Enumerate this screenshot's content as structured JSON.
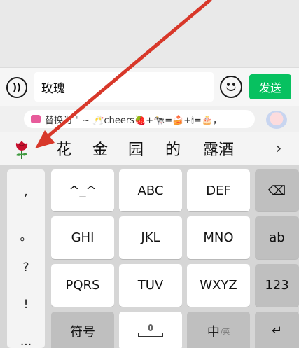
{
  "input_bar": {
    "message_text": "玫瑰",
    "send_label": "发送",
    "voice_icon": "voice-icon",
    "emoji_icon": "emoji-icon"
  },
  "suggestion": {
    "text": "替换为 \" ~ 🥂cheers🍓+🐄=🍰+🕯=🎂，",
    "sticker_icon": "sticker-icon"
  },
  "candidates": {
    "emoji": "rose",
    "items": [
      "花",
      "金",
      "园",
      "的",
      "露酒"
    ],
    "more_icon": "chevron-right-icon",
    "more_glyph": "›"
  },
  "keyboard": {
    "punctuation": [
      ",",
      "。",
      "?",
      "!",
      "..."
    ],
    "rows": [
      [
        "^_^",
        "ABC",
        "DEF",
        "⌫"
      ],
      [
        "GHI",
        "JKL",
        "MNO",
        "ab"
      ],
      [
        "PQRS",
        "TUV",
        "WXYZ",
        "123"
      ],
      [
        "符号",
        "space",
        "中",
        "↵"
      ]
    ],
    "zh_sub": "/英"
  },
  "colors": {
    "send_green": "#07c160",
    "arrow_red": "#d8382a"
  }
}
